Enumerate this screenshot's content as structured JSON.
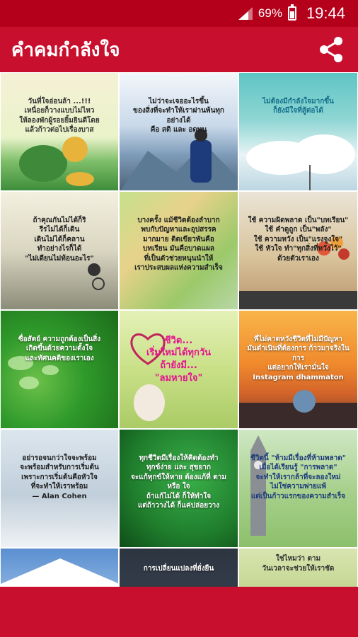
{
  "status_bar": {
    "battery": "69%",
    "time": "19:44"
  },
  "app_bar": {
    "title": "คำคมกำลังใจ"
  },
  "tiles": [
    {
      "caption": "วันที่ใจอ่อนล้า ...!!!\nเหนื่อยก็วางแบบไม่ไหว\nให้ลองพักผู้รอยยิ้มยินดีโดย\nแล้วก้าวต่อไปเรื่องบาส"
    },
    {
      "caption": "ไม่ว่าจะเจออะไรขึ้น\nของสิ่งที่จะทำให้เราผ่านพ้นทุกอย่างได้\nคือ สติ และ อดทน"
    },
    {
      "caption": "ไม่ต้องมีกำลังใจมากขึ้น\nก็ยังมีใจที่สู้ต่อได้"
    },
    {
      "caption": "ถ้าคุณกันไม่ได้ก็ริ\nรีรไม่ได้ก็เดิน\nเดินไม่ได้ก็คลาน\nทำอย่างไรก็ได้\n\"ไม่เดียนไม่ท้อนอะไร\""
    },
    {
      "caption": "บางครั้ง แม้ชีวิตต้องลำบาก\nพบกับปัญหาและอุปสรรค\nมากมาย ติดเขียวพันคือ\nบทเรียน มันคือบาดแผล\nที่เป็นตัวช่วยหนุนนำให้\nเราประสบผลแห่งความสำเร็จ"
    },
    {
      "caption": "ใช้ ความผิดพลาด เป็น\"บทเรียน\"\nใช้ คำดูถูก เป็น\"พลัง\"\nใช้ ความหวัง เป็น\"แรงจูงใจ\"\nใช้ หัวใจ ทำ\"ทุกสิ่งที่หวังไว้\"\nด้วยตัวเราเอง"
    },
    {
      "caption": "ซื่อสัตย์ ความถูกต้องเป็นสิ่ง\nเกิดขึ้นด้วยความตั้งใจ\nและทัศนคติของเราเอง"
    },
    {
      "caption": "ชีวิต...\nเริ่มใหม่ได้ทุกวัน\nถ้ายังมี...\n\"ลมหายใจ\""
    },
    {
      "caption": "พี่ไม่คาดหวังชีวิตที่ไม่มีปัญหา\nมันดำเนินที่ต้องการ ก้าวมาจริงในการ\nแต่อยากให้เรามั่นใจ\nInstagram dhammaton"
    },
    {
      "caption": "อย่ารอจนกว่าใจจะพร้อม\nจะพร้อมสำหรับการเริ่มต้น\nเพราะการเริ่มต้นคือหัวใจ\nที่จะทำให้เราพร้อม\n— Alan Cohen"
    },
    {
      "caption": "ทุกชีวิตมีเรื่องให้คิดต้องทำ\nทุกข์ง่าย และ สุขยาก\nจะแก้ทุกข์ให้หาย ต้องแก้ที่ ตาม หรือ ใจ\nถ้าแก้ไม่ได้ ก็ให้ทำใจ\nแต่ถ้าวางได้ ก็แค่ปล่อยวาง"
    },
    {
      "caption": "ชีวิตนี้ \"ห้ามมีเรื่องที่ห้ามพลาด\"\nเมื่อได้เรียนรู้ \"การพลาด\"\nจะทำให้เรากล้าที่จะลองใหม่\nไม่ใช่ความพ่ายแพ้\nแต่เป็นก้าวแรกของความสำเร็จ"
    },
    {
      "caption": ""
    },
    {
      "caption": "การเปลี่ยนแปลงที่ยั่งยืน"
    },
    {
      "caption": "ใช่ไหมว่า ตาม\nวันเวลาจะช่วยให้เราชัด"
    }
  ]
}
